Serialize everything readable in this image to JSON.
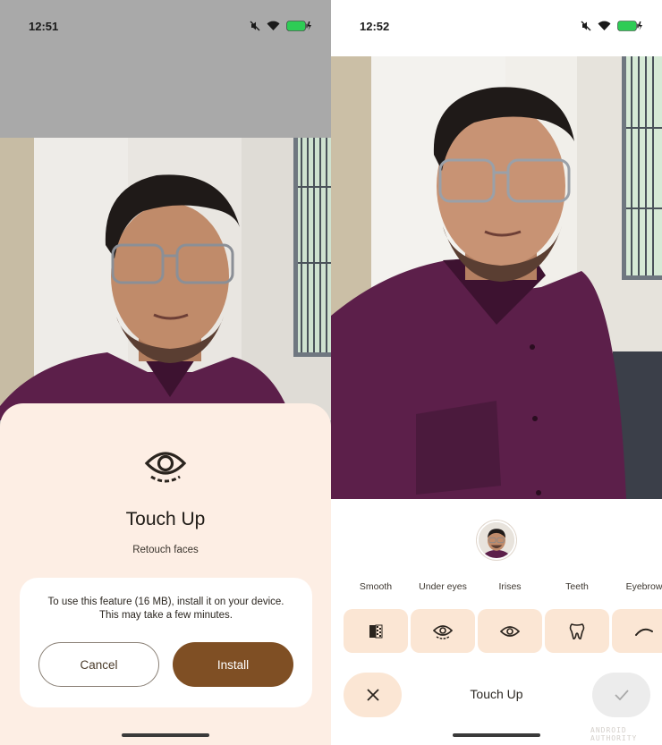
{
  "left": {
    "status": {
      "time": "12:51"
    },
    "sheet": {
      "title": "Touch Up",
      "subtitle": "Retouch faces",
      "message_line1": "To use this feature (16 MB), install it on your device.",
      "message_line2": "This may take a few minutes.",
      "cancel_label": "Cancel",
      "install_label": "Install"
    }
  },
  "right": {
    "status": {
      "time": "12:52"
    },
    "tools": [
      {
        "label": "Smooth",
        "icon": "smooth-icon"
      },
      {
        "label": "Under eyes",
        "icon": "under-eyes-icon"
      },
      {
        "label": "Irises",
        "icon": "eye-icon"
      },
      {
        "label": "Teeth",
        "icon": "tooth-icon"
      },
      {
        "label": "Eyebrow",
        "icon": "eyebrow-icon"
      }
    ],
    "bottom_title": "Touch Up"
  },
  "colors": {
    "accent": "#7f4f24",
    "sheet_bg": "#fdeee4",
    "tool_bg": "#fbe6d4",
    "shirt": "#5c1f4a"
  },
  "watermark": "ANDROID AUTHORITY"
}
